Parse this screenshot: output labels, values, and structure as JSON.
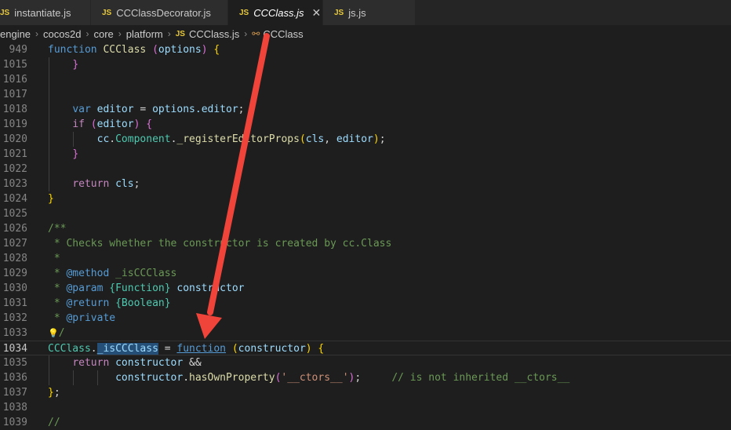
{
  "tabs": [
    {
      "badge": "JS",
      "label": "instantiate.js"
    },
    {
      "badge": "JS",
      "label": "CCClassDecorator.js"
    },
    {
      "badge": "JS",
      "label": "CCClass.js",
      "close": "✕"
    },
    {
      "badge": "JS",
      "label": "js.js"
    }
  ],
  "breadcrumb": {
    "items": [
      "engine",
      "cocos2d",
      "core",
      "platform"
    ],
    "file_badge": "JS",
    "file": "CCClass.js",
    "symbol": "CCClass"
  },
  "gutter": [
    "949",
    "1015",
    "1016",
    "1017",
    "1018",
    "1019",
    "1020",
    "1021",
    "1022",
    "1023",
    "1024",
    "1025",
    "1026",
    "1027",
    "1028",
    "1029",
    "1030",
    "1031",
    "1032",
    "1033",
    "1034",
    "1035",
    "1036",
    "1037",
    "1038",
    "1039"
  ],
  "code": {
    "l949_kw": "function",
    "l949_name": "CCClass",
    "l949_open": "(",
    "l949_param": "options",
    "l949_close": ")",
    "l949_brace": "{",
    "l1015_brace": "}",
    "l1018_kw": "var",
    "l1018_var": "editor",
    "l1018_eq": " = ",
    "l1018_obj": "options",
    "l1018_prop": ".editor",
    "l1018_semi": ";",
    "l1019_if": "if",
    "l1019_open": "(",
    "l1019_var": "editor",
    "l1019_close": ")",
    "l1019_brace": "{",
    "l1020_obj": "cc",
    "l1020_cls": "Component",
    "l1020_dot": ".",
    "l1020_fn": "_registerEditorProps",
    "l1020_open": "(",
    "l1020_a1": "cls",
    "l1020_comma": ", ",
    "l1020_a2": "editor",
    "l1020_close": ")",
    "l1020_semi": ";",
    "l1021_brace": "}",
    "l1023_ret": "return",
    "l1023_var": "cls",
    "l1023_semi": ";",
    "l1024_brace": "}",
    "l1026": "/**",
    "l1027": " * Checks whether the constructor is created by cc.Class",
    "l1028": " *",
    "l1029_star": " * ",
    "l1029_tag": "@method",
    "l1029_rest": " _isCCClass",
    "l1030_star": " * ",
    "l1030_tag": "@param",
    "l1030_type": " {Function}",
    "l1030_name": " constructor",
    "l1031_star": " * ",
    "l1031_tag": "@return",
    "l1031_type": " {Boolean}",
    "l1032_star": " * ",
    "l1032_tag": "@private",
    "l1033_bulb": "💡",
    "l1033_end": "/",
    "l1034_cls": "CCClass",
    "l1034_dot": ".",
    "l1034_prop": "_isCCClass",
    "l1034_eq": " = ",
    "l1034_kw": "function",
    "l1034_open": "(",
    "l1034_param": "constructor",
    "l1034_close": ")",
    "l1034_brace": "{",
    "l1035_ret": "return",
    "l1035_var": "constructor",
    "l1035_op": " &&",
    "l1036_var": "constructor",
    "l1036_dot": ".",
    "l1036_fn": "hasOwnProperty",
    "l1036_open": "(",
    "l1036_str": "'__ctors__'",
    "l1036_close": ")",
    "l1036_semi": ";",
    "l1036_cm": "// is not inherited __ctors__",
    "l1037_brace": "}",
    "l1037_semi": ";",
    "l1039": "//"
  },
  "colors": {
    "arrow": "#f0443a",
    "keyword": "#569cd6",
    "comment": "#6a9955"
  }
}
